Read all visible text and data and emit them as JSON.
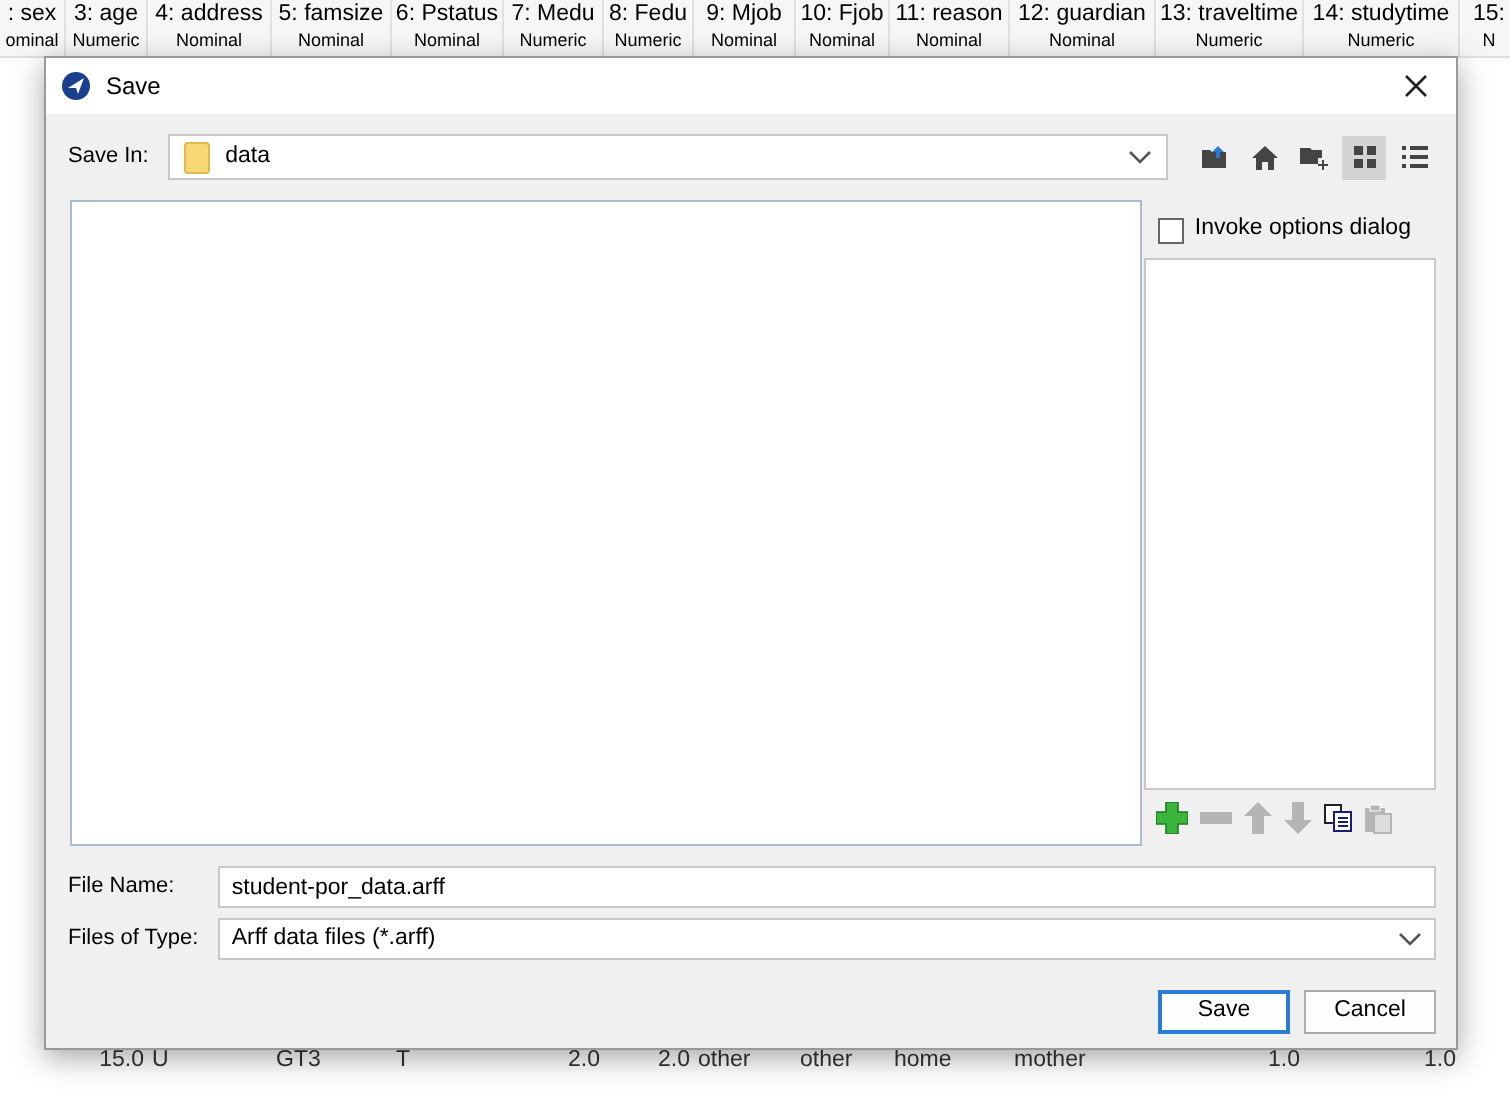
{
  "table": {
    "columns": [
      {
        "name": ": sex",
        "type": "ominal"
      },
      {
        "name": "3: age",
        "type": "Numeric"
      },
      {
        "name": "4: address",
        "type": "Nominal"
      },
      {
        "name": "5: famsize",
        "type": "Nominal"
      },
      {
        "name": "6: Pstatus",
        "type": "Nominal"
      },
      {
        "name": "7: Medu",
        "type": "Numeric"
      },
      {
        "name": "8: Fedu",
        "type": "Numeric"
      },
      {
        "name": "9: Mjob",
        "type": "Nominal"
      },
      {
        "name": "10: Fjob",
        "type": "Nominal"
      },
      {
        "name": "11: reason",
        "type": "Nominal"
      },
      {
        "name": "12: guardian",
        "type": "Nominal"
      },
      {
        "name": "13: traveltime",
        "type": "Numeric"
      },
      {
        "name": "14: studytime",
        "type": "Numeric"
      },
      {
        "name": "15:",
        "type": "N"
      }
    ],
    "rows": [
      {
        "cells": [
          "",
          "15.0",
          "U",
          "GT3",
          "T",
          "2.0",
          "2.0",
          "other",
          "other",
          "home",
          "mother",
          "1.0",
          "1.0"
        ]
      }
    ]
  },
  "dialog": {
    "title": "Save",
    "save_in": {
      "label": "Save In:",
      "value": "data"
    },
    "toolbar": [
      {
        "kind": "up",
        "selected": false
      },
      {
        "kind": "home",
        "selected": false
      },
      {
        "kind": "newfolder",
        "selected": false
      },
      {
        "kind": "grid",
        "selected": true
      },
      {
        "kind": "list",
        "selected": false
      }
    ],
    "invoke_options": {
      "label": "Invoke options dialog",
      "checked": false
    },
    "list_tools": [
      {
        "kind": "add",
        "disabled": false
      },
      {
        "kind": "remove",
        "disabled": true
      },
      {
        "kind": "up",
        "disabled": true
      },
      {
        "kind": "down",
        "disabled": true
      },
      {
        "kind": "copy",
        "disabled": false
      },
      {
        "kind": "paste",
        "disabled": true
      }
    ],
    "file_name": {
      "label": "File Name:",
      "value": "student-por_data.arff"
    },
    "file_type": {
      "label": "Files of Type:",
      "value": "Arff data files (*.arff)"
    },
    "buttons": [
      {
        "label": "Save",
        "default": true
      },
      {
        "label": "Cancel",
        "default": false
      }
    ]
  }
}
